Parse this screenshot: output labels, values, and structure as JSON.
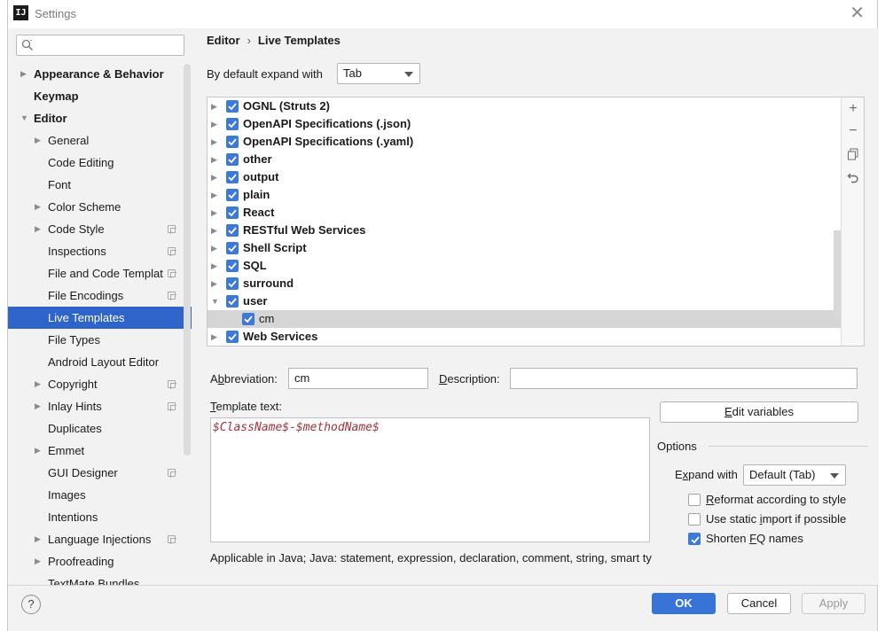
{
  "window": {
    "title": "Settings",
    "app_icon_text": "IJ"
  },
  "search": {
    "placeholder": ""
  },
  "sidebar": {
    "items": [
      {
        "label": "Appearance & Behavior",
        "level": "top",
        "expandable": true,
        "expanded": false
      },
      {
        "label": "Keymap",
        "level": "top",
        "expandable": false
      },
      {
        "label": "Editor",
        "level": "top",
        "expandable": true,
        "expanded": true
      },
      {
        "label": "General",
        "level": "sub",
        "expandable": true,
        "expanded": false
      },
      {
        "label": "Code Editing",
        "level": "sub"
      },
      {
        "label": "Font",
        "level": "sub"
      },
      {
        "label": "Color Scheme",
        "level": "sub",
        "expandable": true,
        "expanded": false
      },
      {
        "label": "Code Style",
        "level": "sub",
        "expandable": true,
        "expanded": false,
        "config_icon": true
      },
      {
        "label": "Inspections",
        "level": "sub",
        "config_icon": true
      },
      {
        "label": "File and Code Templat",
        "level": "sub",
        "config_icon": true
      },
      {
        "label": "File Encodings",
        "level": "sub",
        "config_icon": true
      },
      {
        "label": "Live Templates",
        "level": "sub",
        "selected": true
      },
      {
        "label": "File Types",
        "level": "sub"
      },
      {
        "label": "Android Layout Editor",
        "level": "sub"
      },
      {
        "label": "Copyright",
        "level": "sub",
        "expandable": true,
        "expanded": false,
        "config_icon": true
      },
      {
        "label": "Inlay Hints",
        "level": "sub",
        "expandable": true,
        "expanded": false,
        "config_icon": true
      },
      {
        "label": "Duplicates",
        "level": "sub"
      },
      {
        "label": "Emmet",
        "level": "sub",
        "expandable": true,
        "expanded": false
      },
      {
        "label": "GUI Designer",
        "level": "sub",
        "config_icon": true
      },
      {
        "label": "Images",
        "level": "sub"
      },
      {
        "label": "Intentions",
        "level": "sub"
      },
      {
        "label": "Language Injections",
        "level": "sub",
        "expandable": true,
        "expanded": false,
        "config_icon": true
      },
      {
        "label": "Proofreading",
        "level": "sub",
        "expandable": true,
        "expanded": false
      },
      {
        "label": "TextMate Bundles",
        "level": "sub"
      }
    ]
  },
  "breadcrumb": {
    "parent": "Editor",
    "separator": "›",
    "current": "Live Templates"
  },
  "expand_default": {
    "label": "By default expand with",
    "value": "Tab"
  },
  "template_groups": [
    {
      "name": "OGNL (Struts 2)",
      "checked": true,
      "expanded": false
    },
    {
      "name": "OpenAPI Specifications (.json)",
      "checked": true,
      "expanded": false
    },
    {
      "name": "OpenAPI Specifications (.yaml)",
      "checked": true,
      "expanded": false
    },
    {
      "name": "other",
      "checked": true,
      "expanded": false
    },
    {
      "name": "output",
      "checked": true,
      "expanded": false
    },
    {
      "name": "plain",
      "checked": true,
      "expanded": false
    },
    {
      "name": "React",
      "checked": true,
      "expanded": false
    },
    {
      "name": "RESTful Web Services",
      "checked": true,
      "expanded": false
    },
    {
      "name": "Shell Script",
      "checked": true,
      "expanded": false
    },
    {
      "name": "SQL",
      "checked": true,
      "expanded": false
    },
    {
      "name": "surround",
      "checked": true,
      "expanded": false
    },
    {
      "name": "user",
      "checked": true,
      "expanded": true,
      "children": [
        {
          "name": "cm",
          "checked": true,
          "selected": true
        }
      ]
    },
    {
      "name": "Web Services",
      "checked": true,
      "expanded": false
    }
  ],
  "list_tools": {
    "add": "+",
    "remove": "−",
    "copy": "copy-icon",
    "restore": "undo-icon"
  },
  "abbreviation": {
    "label_pre": "A",
    "label_mnemonic": "b",
    "label_post": "breviation:",
    "value": "cm"
  },
  "description": {
    "label_mnemonic": "D",
    "label_post": "escription:",
    "value": ""
  },
  "template_text": {
    "label_mnemonic": "T",
    "label_post": "emplate text:",
    "value": "$ClassName$-$methodName$"
  },
  "edit_variables": {
    "label_mnemonic": "E",
    "label_post": "dit variables"
  },
  "options": {
    "title": "Options",
    "expand_with": {
      "label_pre": "E",
      "label_mnemonic": "x",
      "label_post": "pand with",
      "value": "Default (Tab)"
    },
    "checkboxes": [
      {
        "label_mnemonic": "R",
        "label_post": "eformat according to style",
        "checked": false
      },
      {
        "label_pre": "Use static ",
        "label_mnemonic": "i",
        "label_post": "mport if possible",
        "checked": false
      },
      {
        "label_pre": "Shorten ",
        "label_mnemonic": "F",
        "label_post": "Q names",
        "checked": true
      }
    ]
  },
  "applicable_text": "Applicable in Java; Java: statement, expression, declaration, comment, string, smart ty",
  "footer": {
    "help": "?",
    "ok": "OK",
    "cancel": "Cancel",
    "apply": "Apply"
  },
  "colors": {
    "accent": "#2f65ca",
    "checkbox": "#3d7ad8",
    "template_variable": "#a0333a"
  }
}
